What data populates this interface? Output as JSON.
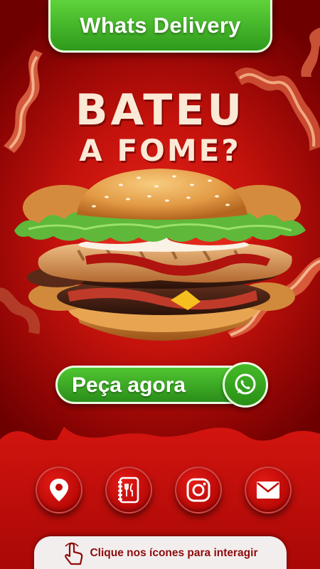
{
  "header": {
    "title": "Whats Delivery"
  },
  "headline": {
    "line1": "BATEU",
    "line2": "A FOME?"
  },
  "cta": {
    "label": "Peça agora",
    "icon": "whatsapp-icon"
  },
  "actions": [
    {
      "name": "location-icon"
    },
    {
      "name": "menu-icon"
    },
    {
      "name": "instagram-icon"
    },
    {
      "name": "email-icon"
    }
  ],
  "footer": {
    "hint": "Clique nos ícones para interagir",
    "icon": "hand-pointer-icon"
  },
  "colors": {
    "accent_green": "#3aa824",
    "brand_red": "#c4120c",
    "dark_red": "#7a0000",
    "cream": "#fbe9d6"
  }
}
